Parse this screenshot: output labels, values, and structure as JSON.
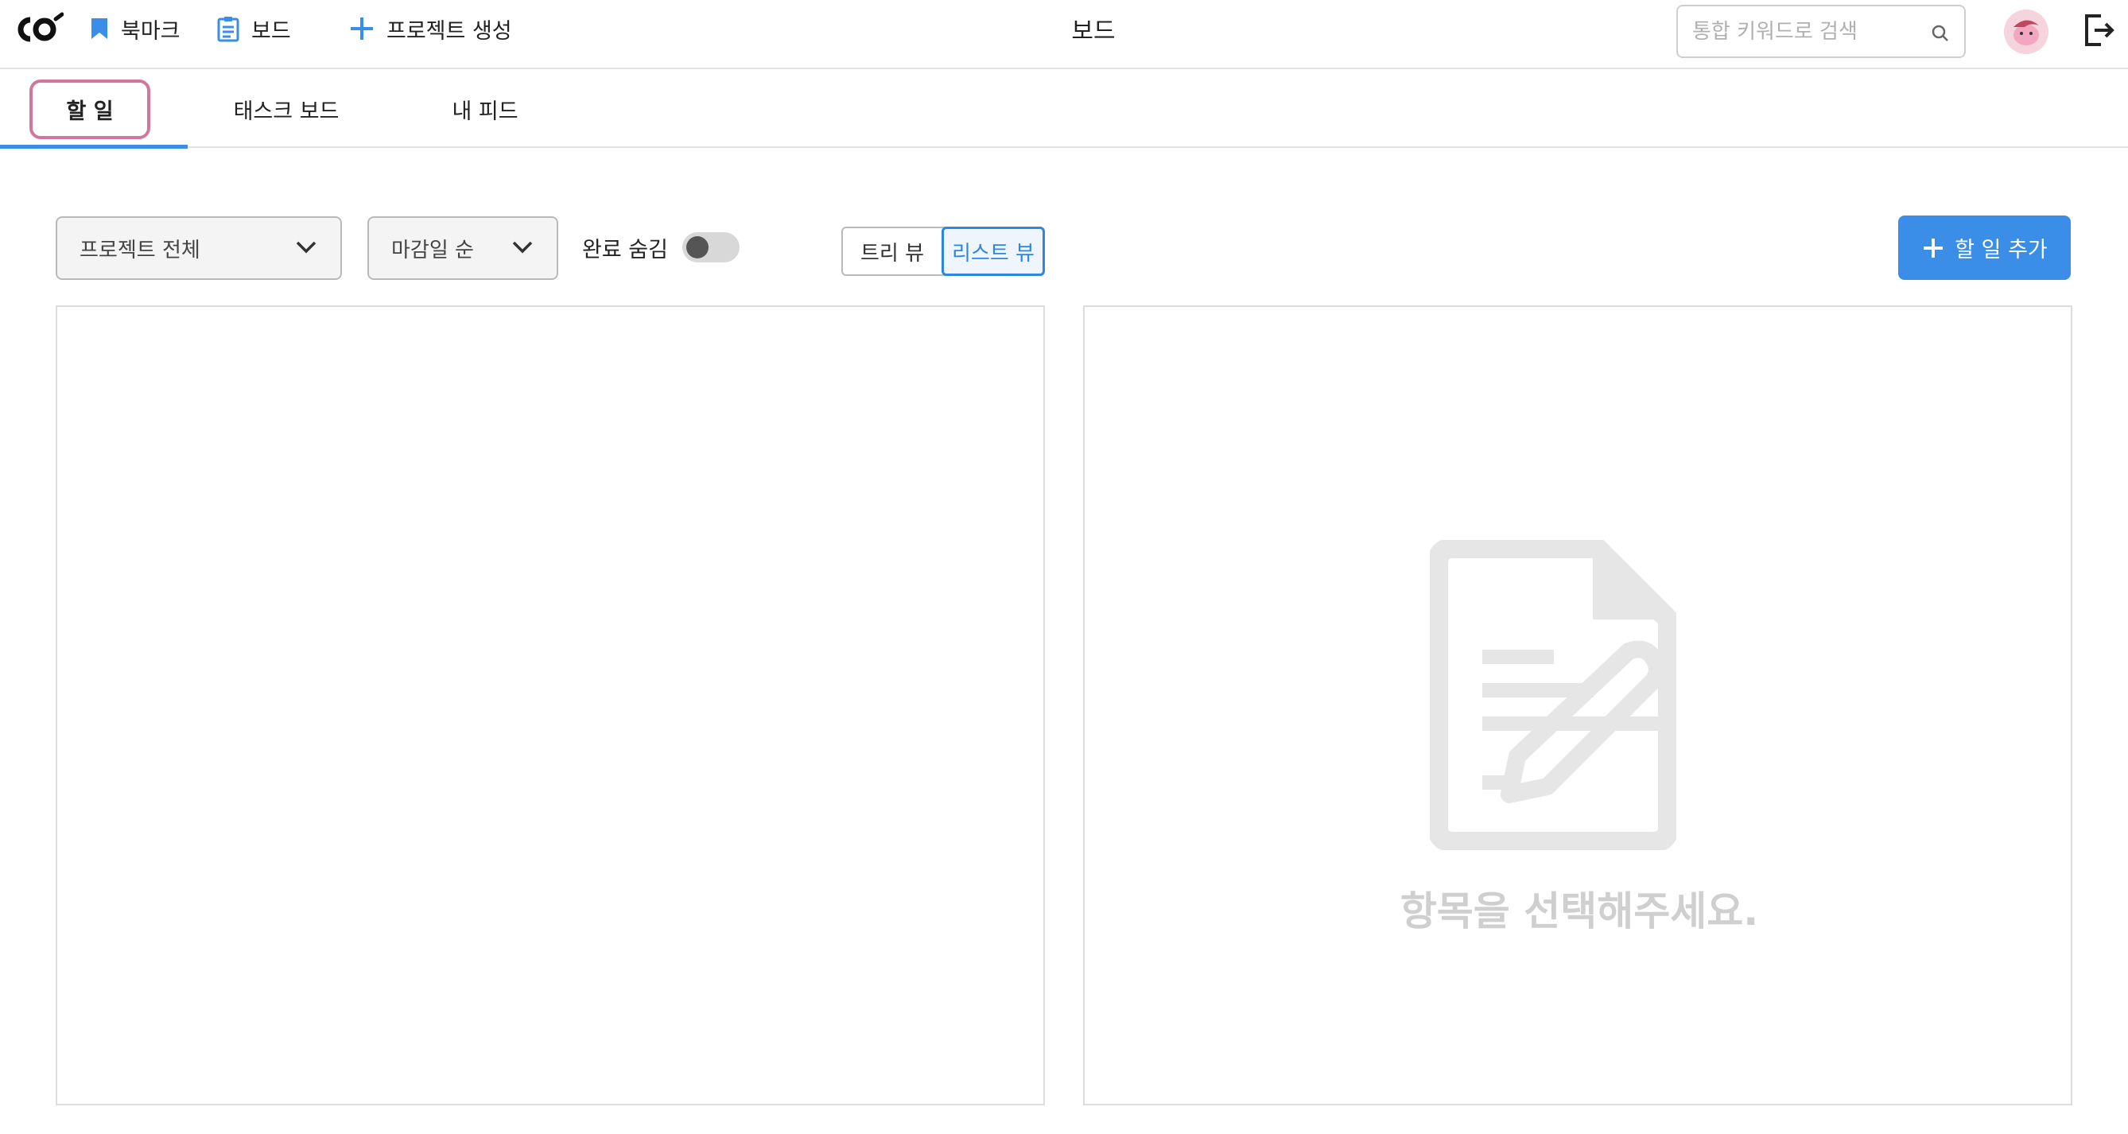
{
  "header": {
    "logo": "logo-icon",
    "nav": [
      {
        "label": "북마크",
        "icon": "bookmark-icon"
      },
      {
        "label": "보드",
        "icon": "clipboard-icon"
      },
      {
        "label": "프로젝트 생성",
        "icon": "plus-icon"
      }
    ],
    "title": "보드",
    "search_placeholder": "통합 키워드로 검색",
    "search_value": ""
  },
  "tabs": [
    {
      "label": "할 일",
      "active": true
    },
    {
      "label": "태스크 보드",
      "active": false
    },
    {
      "label": "내 피드",
      "active": false
    }
  ],
  "toolbar": {
    "project_filter": "프로젝트 전체",
    "sort": "마감일 순",
    "hide_done_label": "완료 숨김",
    "hide_done_on": false,
    "view_tree": "트리 뷰",
    "view_list": "리스트 뷰",
    "selected_view": "list",
    "add_label": "할 일 추가"
  },
  "detail": {
    "empty_message": "항목을 선택해주세요."
  },
  "colors": {
    "accent": "#3b8ee8",
    "tab_highlight": "#d0779b"
  }
}
